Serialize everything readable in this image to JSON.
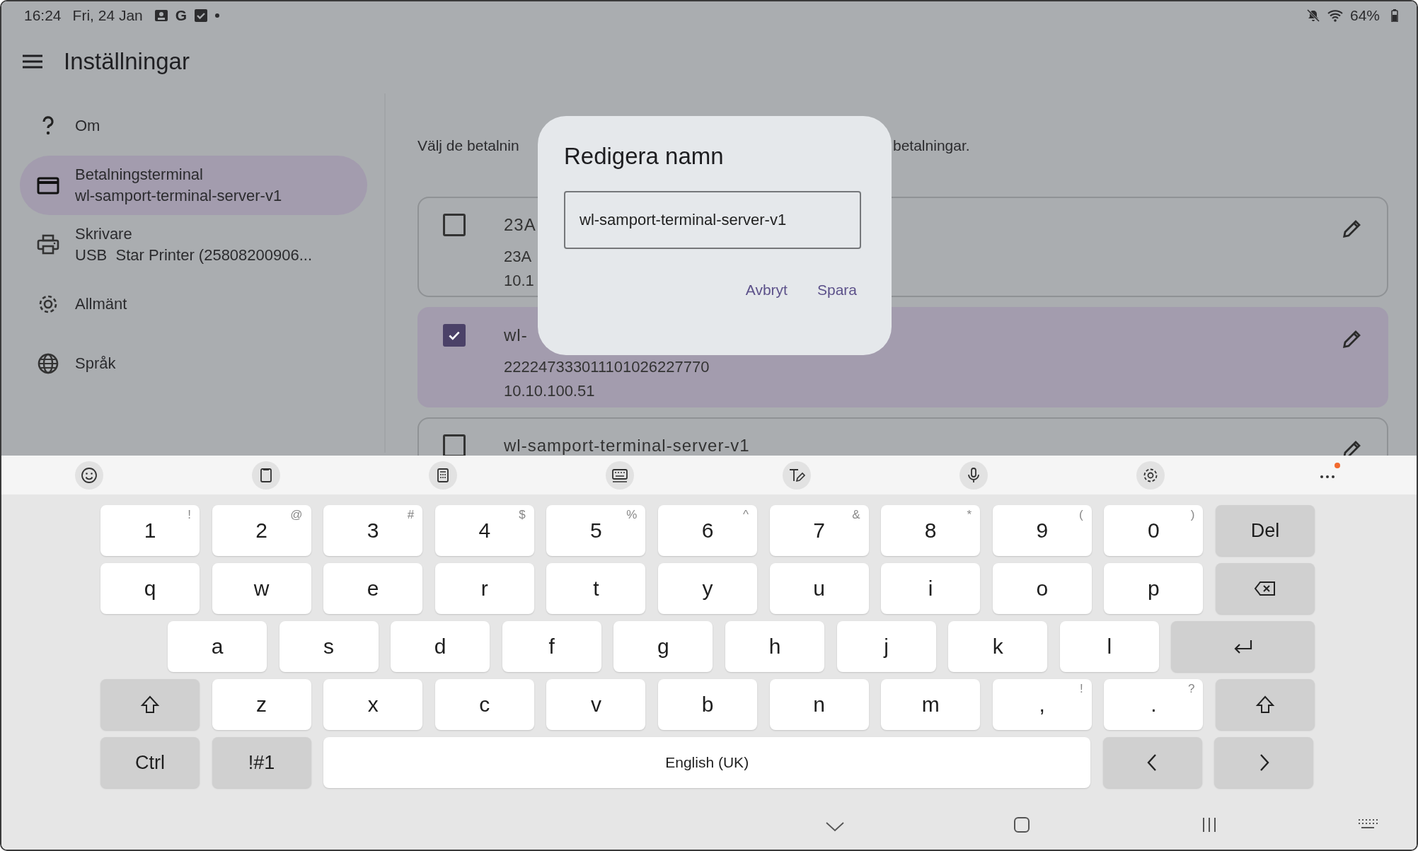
{
  "status_bar": {
    "time": "16:24",
    "date": "Fri, 24 Jan",
    "app_badge": "G",
    "battery": "64%"
  },
  "app_bar": {
    "title": "Inställningar"
  },
  "sidebar": {
    "items": [
      {
        "kind": "help",
        "label": "Om",
        "selected": false
      },
      {
        "kind": "card",
        "label": "Betalningsterminal",
        "sublabel": "wl-samport-terminal-server-v1",
        "selected": true
      },
      {
        "kind": "printer",
        "label": "Skrivare",
        "sublabel": "USB  Star Printer (25808200906...",
        "selected": false
      },
      {
        "kind": "gear",
        "label": "Allmänt",
        "selected": false
      },
      {
        "kind": "globe",
        "label": "Språk",
        "selected": false
      }
    ]
  },
  "content": {
    "intro_left": "Välj de betalnin",
    "intro_right": "betalningar.",
    "terminals": [
      {
        "lines": [
          "23A",
          "23A",
          "10.1"
        ],
        "checked": false
      },
      {
        "lines": [
          "wl-",
          "222247333011101026227770",
          "10.10.100.51"
        ],
        "checked": true
      },
      {
        "lines": [
          "wl-samport-terminal-server-v1"
        ],
        "checked": false
      }
    ]
  },
  "dialog": {
    "title": "Redigera namn",
    "value": "wl-samport-terminal-server-v1",
    "actions": [
      "Avbryt",
      "Spara"
    ]
  },
  "keyboard": {
    "rows": [
      {
        "keys": [
          {
            "kind": "char",
            "label": "1",
            "hint": "!"
          },
          {
            "kind": "char",
            "label": "2",
            "hint": "@"
          },
          {
            "kind": "char",
            "label": "3",
            "hint": "#"
          },
          {
            "kind": "char",
            "label": "4",
            "hint": "$"
          },
          {
            "kind": "char",
            "label": "5",
            "hint": "%"
          },
          {
            "kind": "char",
            "label": "6",
            "hint": "^"
          },
          {
            "kind": "char",
            "label": "7",
            "hint": "&"
          },
          {
            "kind": "char",
            "label": "8",
            "hint": "*"
          },
          {
            "kind": "char",
            "label": "9",
            "hint": "("
          },
          {
            "kind": "char",
            "label": "0",
            "hint": ")"
          },
          {
            "kind": "func",
            "label": "Del"
          }
        ]
      },
      {
        "keys": [
          {
            "kind": "char",
            "label": "q"
          },
          {
            "kind": "char",
            "label": "w"
          },
          {
            "kind": "char",
            "label": "e"
          },
          {
            "kind": "char",
            "label": "r"
          },
          {
            "kind": "char",
            "label": "t"
          },
          {
            "kind": "char",
            "label": "y"
          },
          {
            "kind": "char",
            "label": "u"
          },
          {
            "kind": "char",
            "label": "i"
          },
          {
            "kind": "char",
            "label": "o"
          },
          {
            "kind": "char",
            "label": "p"
          },
          {
            "kind": "backspace"
          }
        ]
      },
      {
        "keys": [
          {
            "kind": "char",
            "label": "a"
          },
          {
            "kind": "char",
            "label": "s"
          },
          {
            "kind": "char",
            "label": "d"
          },
          {
            "kind": "char",
            "label": "f"
          },
          {
            "kind": "char",
            "label": "g"
          },
          {
            "kind": "char",
            "label": "h"
          },
          {
            "kind": "char",
            "label": "j"
          },
          {
            "kind": "char",
            "label": "k"
          },
          {
            "kind": "char",
            "label": "l"
          },
          {
            "kind": "enter"
          }
        ]
      },
      {
        "keys": [
          {
            "kind": "shift"
          },
          {
            "kind": "char",
            "label": "z"
          },
          {
            "kind": "char",
            "label": "x"
          },
          {
            "kind": "char",
            "label": "c"
          },
          {
            "kind": "char",
            "label": "v"
          },
          {
            "kind": "char",
            "label": "b"
          },
          {
            "kind": "char",
            "label": "n"
          },
          {
            "kind": "char",
            "label": "m"
          },
          {
            "kind": "char",
            "label": ",",
            "hint": "!"
          },
          {
            "kind": "char",
            "label": ".",
            "hint": "?"
          },
          {
            "kind": "shift"
          }
        ]
      },
      {
        "keys": [
          {
            "kind": "func",
            "label": "Ctrl"
          },
          {
            "kind": "func",
            "label": "!#1"
          },
          {
            "kind": "space",
            "label": "English (UK)"
          },
          {
            "kind": "left"
          },
          {
            "kind": "right"
          }
        ]
      }
    ]
  }
}
